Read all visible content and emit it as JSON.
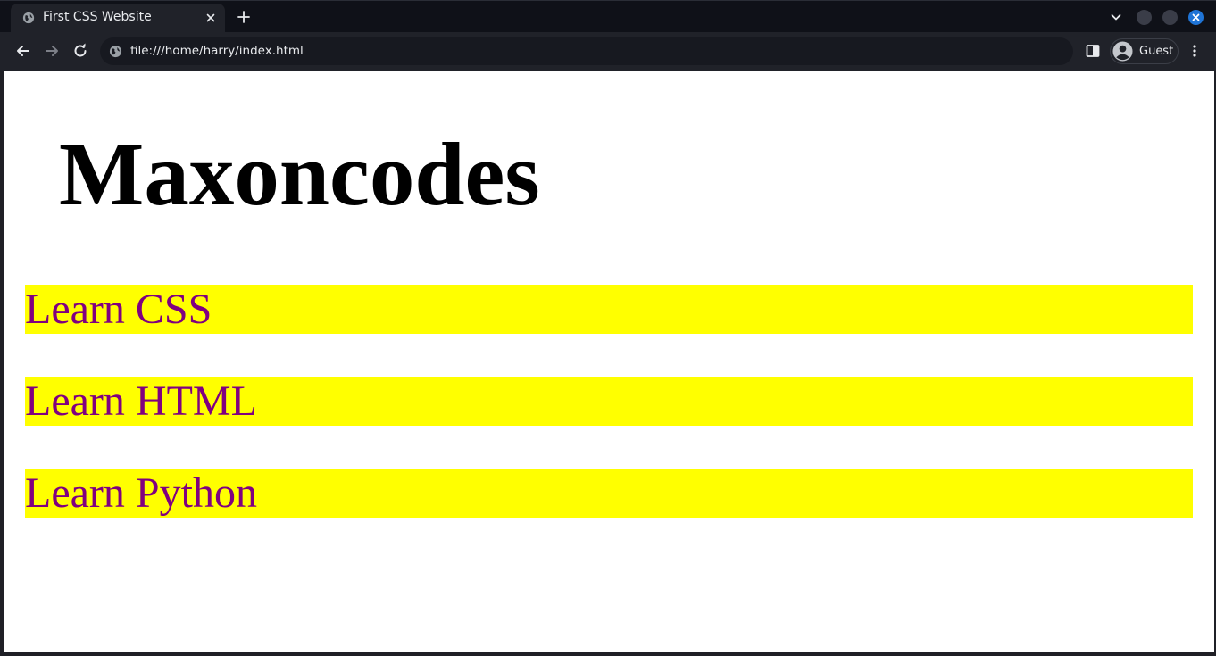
{
  "browser": {
    "tab_title": "First CSS Website",
    "url": "file:///home/harry/index.html",
    "profile_name": "Guest"
  },
  "page": {
    "heading": "Maxoncodes",
    "items": [
      {
        "label": "Learn CSS"
      },
      {
        "label": "Learn HTML"
      },
      {
        "label": "Learn Python"
      }
    ]
  },
  "colors": {
    "item_background": "#ffff00",
    "item_text": "#800080",
    "browser_frame": "#202229",
    "window_close_accent": "#1f74d6"
  },
  "icons": {
    "tab_favicon": "globe-icon",
    "tab_close": "close-icon",
    "new_tab": "plus-icon",
    "tab_list": "chevron-down-icon",
    "back": "arrow-left-icon",
    "forward": "arrow-right-icon",
    "reload": "reload-icon",
    "site_info": "globe-icon",
    "side_panel": "side-panel-icon",
    "profile": "avatar-icon",
    "menu": "more-vert-icon"
  }
}
